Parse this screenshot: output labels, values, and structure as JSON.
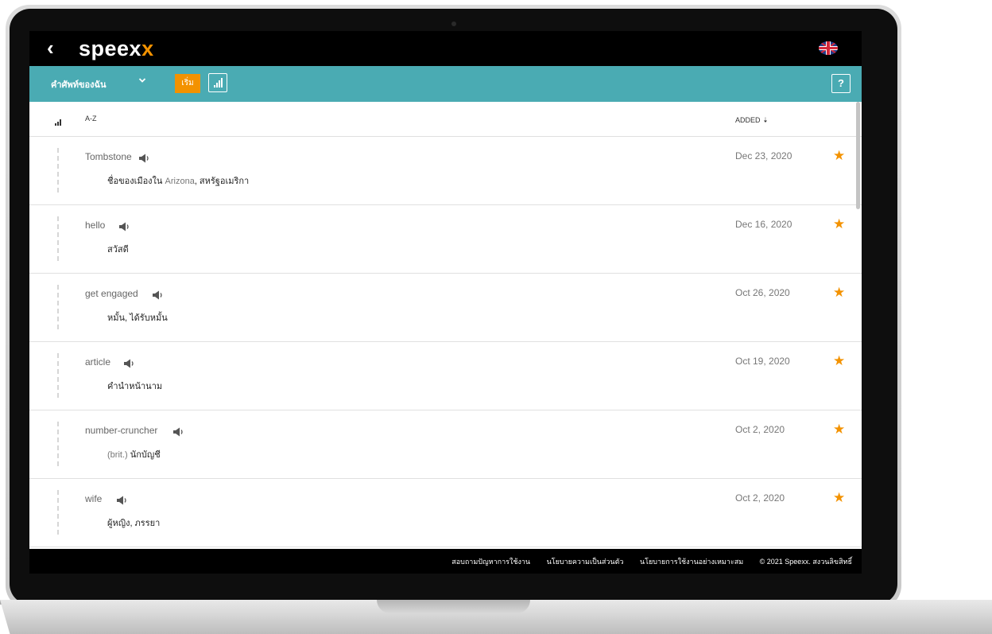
{
  "topbar": {
    "back": "‹",
    "logo_main": "speex",
    "logo_accent": "x",
    "flag_icon": "uk-flag-icon"
  },
  "toolbar": {
    "title": "คำศัพท์ของฉัน",
    "start": "เริ่ม",
    "help": "?"
  },
  "header": {
    "az": "A-Z",
    "added": "ADDED",
    "added_arrow": "🡣"
  },
  "rows": [
    {
      "word": "Tombstone",
      "translation_pre": "ชื่อของเมืองใน ",
      "translation_mid": "Arizona",
      "translation_post": ", สหรัฐอเมริกา",
      "date": "Dec 23, 2020"
    },
    {
      "word": "hello",
      "translation_pre": "สวัสดี",
      "translation_mid": "",
      "translation_post": "",
      "date": "Dec 16, 2020"
    },
    {
      "word": "get engaged",
      "translation_pre": "หมั้น, ได้รับหมั้น",
      "translation_mid": "",
      "translation_post": "",
      "date": "Oct 26, 2020"
    },
    {
      "word": "article",
      "translation_pre": "คำนำหน้านาม",
      "translation_mid": "",
      "translation_post": "",
      "date": "Oct 19, 2020"
    },
    {
      "word": "number-cruncher",
      "translation_pre": "",
      "translation_mid": "(brit.) ",
      "translation_post": "นักบัญชี",
      "date": "Oct 2, 2020"
    },
    {
      "word": "wife",
      "translation_pre": "ผู้หญิง, ภรรยา",
      "translation_mid": "",
      "translation_post": "",
      "date": "Oct 2, 2020"
    }
  ],
  "footer": {
    "link1": "สอบถามปัญหาการใช้งาน",
    "link2": "นโยบายความเป็นส่วนตัว",
    "link3": "นโยบายการใช้งานอย่างเหมาะสม",
    "copyright": "© 2021 Speexx. สงวนลิขสิทธิ์"
  },
  "colors": {
    "accent": "#f39200",
    "toolbar": "#4aabb3",
    "topbar": "#000000"
  }
}
